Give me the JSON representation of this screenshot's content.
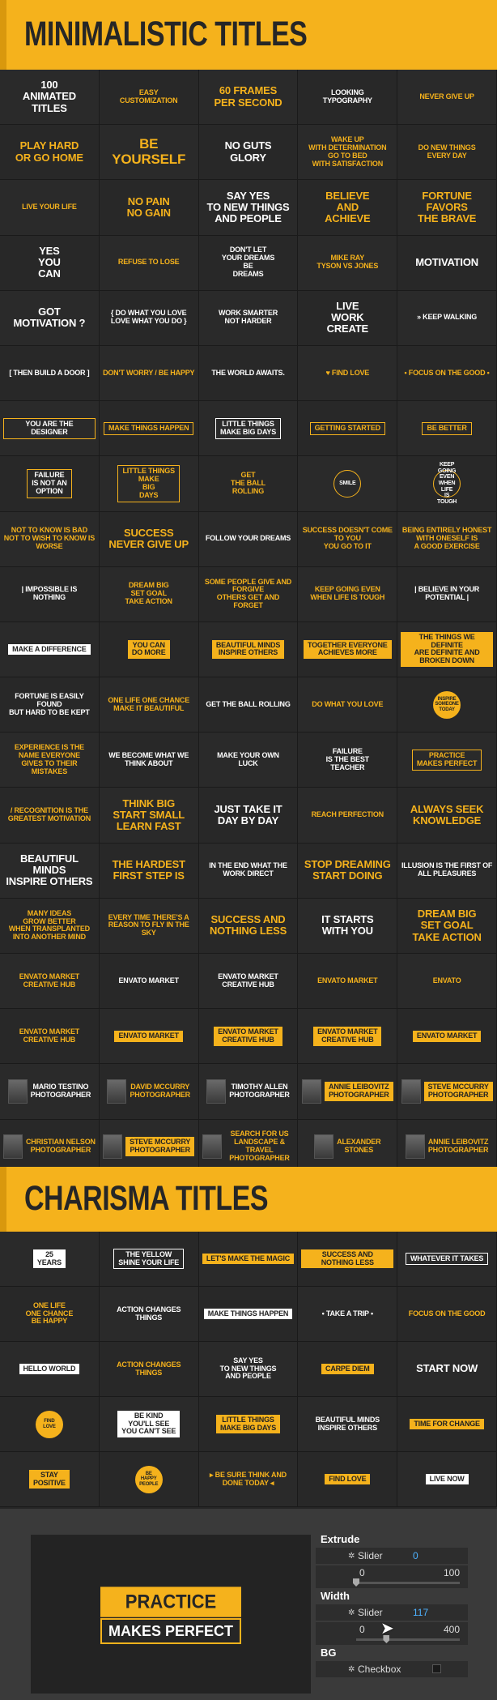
{
  "section1_title": "MINIMALISTIC TITLES",
  "section2_title": "CHARISMA TITLES",
  "colors": {
    "accent": "#f5b21c",
    "background": "#262626",
    "panel": "#3a3a3a"
  },
  "minimal_titles": [
    {
      "t": "100\nANIMATED\nTITLES",
      "s": "big w"
    },
    {
      "t": "EASY\nCUSTOMIZATION",
      "s": "y"
    },
    {
      "t": "60 FRAMES\nPER SECOND",
      "s": "big y"
    },
    {
      "t": "LOOKING\nTYPOGRAPHY",
      "s": "w"
    },
    {
      "t": "NEVER GIVE UP",
      "s": "y"
    },
    {
      "t": "PLAY HARD\nOR GO HOME",
      "s": "big y"
    },
    {
      "t": "BE\nYOURSELF",
      "s": "huge y"
    },
    {
      "t": "NO GUTS\nGLORY",
      "s": "big w"
    },
    {
      "t": "WAKE UP\nWITH DETERMINATION\nGO TO BED\nWITH SATISFACTION",
      "s": "y"
    },
    {
      "t": "DO NEW THINGS\nEVERY DAY",
      "s": "y"
    },
    {
      "t": "LIVE YOUR LIFE",
      "s": "y"
    },
    {
      "t": "NO PAIN\nNO GAIN",
      "s": "big y"
    },
    {
      "t": "SAY YES\nTO NEW THINGS\nAND PEOPLE",
      "s": "big w"
    },
    {
      "t": "BELIEVE\nAND\nACHIEVE",
      "s": "big y"
    },
    {
      "t": "FORTUNE\nFAVORS\nTHE BRAVE",
      "s": "big y"
    },
    {
      "t": "YES\nYOU\nCAN",
      "s": "big w"
    },
    {
      "t": "REFUSE TO LOSE",
      "s": "y"
    },
    {
      "t": "DON'T LET\nYOUR DREAMS\nBE\nDREAMS",
      "s": "w"
    },
    {
      "t": "MIKE    RAY\nTYSON VS JONES",
      "s": "y"
    },
    {
      "t": "MOTIVATION",
      "s": "big w"
    },
    {
      "t": "GOT\nMOTIVATION ?",
      "s": "big w"
    },
    {
      "t": "{ DO WHAT YOU LOVE\nLOVE WHAT YOU DO }",
      "s": "w"
    },
    {
      "t": "WORK SMARTER\nNOT HARDER",
      "s": "w"
    },
    {
      "t": "LIVE\nWORK\nCREATE",
      "s": "big w"
    },
    {
      "t": "» KEEP WALKING",
      "s": "w"
    },
    {
      "t": "[ THEN BUILD A DOOR ]",
      "s": "w"
    },
    {
      "t": "DON'T WORRY / BE HAPPY",
      "s": "y"
    },
    {
      "t": "THE WORLD AWAITS.",
      "s": "w"
    },
    {
      "t": "♥ FIND LOVE",
      "s": "y"
    },
    {
      "t": "• FOCUS ON THE GOOD •",
      "s": "y"
    },
    {
      "t": "YOU ARE THE DESIGNER",
      "s": "boxed w"
    },
    {
      "t": "MAKE THINGS HAPPEN",
      "s": "boxed y"
    },
    {
      "t": "LITTLE THINGS\nMAKE BIG DAYS",
      "s": "boxw w"
    },
    {
      "t": "GETTING STARTED",
      "s": "boxed y"
    },
    {
      "t": "BE BETTER",
      "s": "boxed y"
    },
    {
      "t": "FAILURE\nIS NOT AN\nOPTION",
      "s": "boxed w"
    },
    {
      "t": "LITTLE THINGS\nMAKE\nBIG\nDAYS",
      "s": "boxed y"
    },
    {
      "t": "GET\nTHE BALL\nROLLING",
      "s": "y"
    },
    {
      "t": "SMILE",
      "s": "circ w"
    },
    {
      "t": "KEEP GOING\nEVEN WHEN LIFE\nIS TOUGH",
      "s": "circ w"
    },
    {
      "t": "NOT TO KNOW IS BAD\nNOT TO WISH TO KNOW IS WORSE",
      "s": "y"
    },
    {
      "t": "SUCCESS\nNEVER GIVE UP",
      "s": "big y"
    },
    {
      "t": "FOLLOW YOUR DREAMS",
      "s": "w"
    },
    {
      "t": "SUCCESS DOESN'T COME TO YOU\nYOU GO TO IT",
      "s": "y"
    },
    {
      "t": "BEING ENTIRELY HONEST\nWITH ONESELF IS\nA GOOD EXERCISE",
      "s": "y"
    },
    {
      "t": "| IMPOSSIBLE IS\nNOTHING",
      "s": "w"
    },
    {
      "t": "DREAM BIG\nSET GOAL\nTAKE ACTION",
      "s": "y"
    },
    {
      "t": "SOME PEOPLE GIVE AND FORGIVE\nOTHERS GET AND FORGET",
      "s": "y"
    },
    {
      "t": "KEEP GOING EVEN\nWHEN LIFE IS TOUGH",
      "s": "y"
    },
    {
      "t": "| BELIEVE IN YOUR POTENTIAL |",
      "s": "w"
    },
    {
      "t": "MAKE A DIFFERENCE",
      "s": "fillw"
    },
    {
      "t": "YOU CAN\nDO MORE",
      "s": "filly"
    },
    {
      "t": "BEAUTIFUL MINDS\nINSPIRE OTHERS",
      "s": "filly"
    },
    {
      "t": "TOGETHER EVERYONE\nACHIEVES MORE",
      "s": "filly"
    },
    {
      "t": "THE THINGS WE DEFINITE\nARE DEFINITE AND\nBROKEN DOWN",
      "s": "filly"
    },
    {
      "t": "FORTUNE IS EASILY FOUND\nBUT HARD TO BE KEPT",
      "s": "w"
    },
    {
      "t": "ONE LIFE ONE CHANCE\nMAKE IT BEAUTIFUL",
      "s": "y"
    },
    {
      "t": "GET THE BALL ROLLING",
      "s": "w"
    },
    {
      "t": "DO WHAT YOU LOVE",
      "s": "y"
    },
    {
      "t": "INSPIRE\nSOMEONE\nTODAY",
      "s": "circy"
    },
    {
      "t": "EXPERIENCE IS THE NAME EVERYONE\nGIVES TO THEIR MISTAKES",
      "s": "y"
    },
    {
      "t": "WE BECOME WHAT WE THINK ABOUT",
      "s": "w"
    },
    {
      "t": "MAKE YOUR OWN\nLUCK",
      "s": "w"
    },
    {
      "t": "FAILURE\nIS THE BEST\nTEACHER",
      "s": "w"
    },
    {
      "t": "PRACTICE\nMAKES PERFECT",
      "s": "boxed y"
    },
    {
      "t": "/ RECOGNITION IS THE GREATEST MOTIVATION",
      "s": "y"
    },
    {
      "t": "THINK BIG\nSTART SMALL\nLEARN FAST",
      "s": "big y"
    },
    {
      "t": "JUST TAKE IT\nDAY BY DAY",
      "s": "big w"
    },
    {
      "t": "REACH PERFECTION",
      "s": "y"
    },
    {
      "t": "ALWAYS SEEK\nKNOWLEDGE",
      "s": "big y"
    },
    {
      "t": "BEAUTIFUL\nMINDS\nINSPIRE OTHERS",
      "s": "big w"
    },
    {
      "t": "THE HARDEST\nFIRST STEP IS",
      "s": "big y"
    },
    {
      "t": "IN THE END WHAT THE WORK DIRECT",
      "s": "w"
    },
    {
      "t": "STOP DREAMING\nSTART DOING",
      "s": "big y"
    },
    {
      "t": "ILLUSION IS THE FIRST OF\nALL PLEASURES",
      "s": "w"
    },
    {
      "t": "MANY IDEAS\nGROW BETTER\nWHEN TRANSPLANTED\nINTO ANOTHER MIND",
      "s": "y"
    },
    {
      "t": "EVERY TIME THERE'S A REASON TO FLY IN THE SKY",
      "s": "y"
    },
    {
      "t": "SUCCESS AND\nNOTHING LESS",
      "s": "big y"
    },
    {
      "t": "IT STARTS\nWITH YOU",
      "s": "big w"
    },
    {
      "t": "DREAM BIG\nSET GOAL\nTAKE ACTION",
      "s": "big y"
    },
    {
      "t": "ENVATO MARKET\nCREATIVE HUB",
      "s": "y"
    },
    {
      "t": "ENVATO MARKET",
      "s": "w"
    },
    {
      "t": "ENVATO MARKET\nCREATIVE HUB",
      "s": "w"
    },
    {
      "t": "ENVATO MARKET",
      "s": "y"
    },
    {
      "t": "ENVATO",
      "s": "y"
    },
    {
      "t": "ENVATO MARKET\nCREATIVE HUB",
      "s": "y"
    },
    {
      "t": "ENVATO MARKET",
      "s": "filly"
    },
    {
      "t": "ENVATO MARKET\nCREATIVE HUB",
      "s": "filly"
    },
    {
      "t": "ENVATO MARKET\nCREATIVE HUB",
      "s": "filly"
    },
    {
      "t": "ENVATO MARKET",
      "s": "filly"
    },
    {
      "t": "MARIO TESTINO\nPHOTOGRAPHER",
      "s": "w",
      "photo": true
    },
    {
      "t": "DAVID MCCURRY\nPHOTOGRAPHER",
      "s": "y",
      "photo": true
    },
    {
      "t": "TIMOTHY ALLEN\nPHOTOGRAPHER",
      "s": "w",
      "photo": true
    },
    {
      "t": "ANNIE LEIBOVITZ\nPHOTOGRAPHER",
      "s": "filly",
      "photo": true
    },
    {
      "t": "STEVE MCCURRY\nPHOTOGRAPHER",
      "s": "filly",
      "photo": true
    },
    {
      "t": "CHRISTIAN NELSON\nPHOTOGRAPHER",
      "s": "y",
      "photo": true
    },
    {
      "t": "STEVE MCCURRY\nPHOTOGRAPHER",
      "s": "filly",
      "photo": true
    },
    {
      "t": "SEARCH FOR US\nLANDSCAPE & TRAVEL\nPHOTOGRAPHER",
      "s": "y",
      "photo": true
    },
    {
      "t": "ALEXANDER\nSTONES",
      "s": "y",
      "photo": true
    },
    {
      "t": "ANNIE LEIBOVITZ\nPHOTOGRAPHER",
      "s": "y",
      "photo": true
    }
  ],
  "charisma_titles": [
    {
      "t": "25\nYEARS",
      "s": "fillw"
    },
    {
      "t": "THE YELLOW\nSHINE YOUR LIFE",
      "s": "boxw w"
    },
    {
      "t": "LET'S MAKE THE MAGIC",
      "s": "filly"
    },
    {
      "t": "SUCCESS AND NOTHING LESS",
      "s": "filly"
    },
    {
      "t": "WHATEVER IT TAKES",
      "s": "boxw w"
    },
    {
      "t": "ONE LIFE\nONE CHANCE\nBE HAPPY",
      "s": "y"
    },
    {
      "t": "ACTION CHANGES THINGS",
      "s": "w"
    },
    {
      "t": "MAKE THINGS HAPPEN",
      "s": "fillw"
    },
    {
      "t": "• TAKE A TRIP •",
      "s": "w"
    },
    {
      "t": "FOCUS ON THE GOOD",
      "s": "y"
    },
    {
      "t": "HELLO WORLD",
      "s": "fillw"
    },
    {
      "t": "ACTION CHANGES THINGS",
      "s": "y"
    },
    {
      "t": "SAY YES\nTO NEW THINGS\nAND PEOPLE",
      "s": "w"
    },
    {
      "t": "CARPE DIEM",
      "s": "filly"
    },
    {
      "t": "START NOW",
      "s": "big w"
    },
    {
      "t": "FIND\nLOVE",
      "s": "circy"
    },
    {
      "t": "BE KIND\nYOU'LL SEE\nYOU CAN'T SEE",
      "s": "fillw"
    },
    {
      "t": "LITTLE THINGS\nMAKE BIG DAYS",
      "s": "filly"
    },
    {
      "t": "BEAUTIFUL MINDS\nINSPIRE OTHERS",
      "s": "w"
    },
    {
      "t": "TIME FOR CHANGE",
      "s": "filly"
    },
    {
      "t": "STAY\nPOSITIVE",
      "s": "filly"
    },
    {
      "t": "BE\nHAPPY\nPEOPLE",
      "s": "circy"
    },
    {
      "t": "▸ BE SURE THINK AND DONE TODAY ◂",
      "s": "y"
    },
    {
      "t": "FIND LOVE",
      "s": "filly"
    },
    {
      "t": "LIVE NOW",
      "s": "fillw"
    }
  ],
  "preview": {
    "line1": "PRACTICE",
    "line2": "MAKES PERFECT"
  },
  "properties": {
    "extrude_label": "Extrude",
    "extrude_slider_label": "Slider",
    "extrude_value": "0",
    "extrude_min": "0",
    "extrude_max": "100",
    "extrude_fraction": 0,
    "width_label": "Width",
    "width_slider_label": "Slider",
    "width_value": "117",
    "width_min": "0",
    "width_max": "400",
    "width_fraction": 0.2925,
    "bg_label": "BG",
    "checkbox_label": "Checkbox"
  }
}
